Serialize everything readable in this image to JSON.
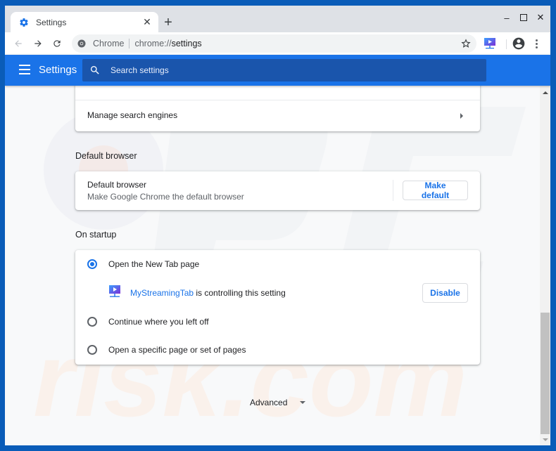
{
  "window": {
    "minimize_label": "–",
    "maximize_label": "☐",
    "close_label": "✕"
  },
  "tab": {
    "title": "Settings",
    "icon": "gear-icon",
    "close_label": "✕",
    "new_tab_label": "+"
  },
  "toolbar": {
    "back_icon": "arrow-left-icon",
    "forward_icon": "arrow-right-icon",
    "reload_icon": "reload-icon",
    "site_label": "Chrome",
    "url_prefix": "chrome://",
    "url_path": "settings",
    "bookmark_icon": "star-icon",
    "extension_icon": "mystreamingtab-extension-icon",
    "profile_icon": "account-circle-icon",
    "menu_icon": "more-vert-icon"
  },
  "header": {
    "title": "Settings",
    "search_placeholder": "Search settings"
  },
  "search_engine_section": {
    "manage_label": "Manage search engines"
  },
  "default_browser": {
    "section_title": "Default browser",
    "row_title": "Default browser",
    "row_subtitle": "Make Google Chrome the default browser",
    "button_label": "Make default"
  },
  "on_startup": {
    "section_title": "On startup",
    "options": [
      {
        "label": "Open the New Tab page",
        "selected": true
      },
      {
        "label": "Continue where you left off",
        "selected": false
      },
      {
        "label": "Open a specific page or set of pages",
        "selected": false
      }
    ],
    "extension_notice": {
      "extension_name": "MyStreamingTab",
      "text": " is controlling this setting",
      "button_label": "Disable"
    }
  },
  "advanced": {
    "label": "Advanced"
  },
  "colors": {
    "accent": "#1a73e8",
    "header_bg": "#1a73e8",
    "search_bg": "#1a55ac"
  }
}
